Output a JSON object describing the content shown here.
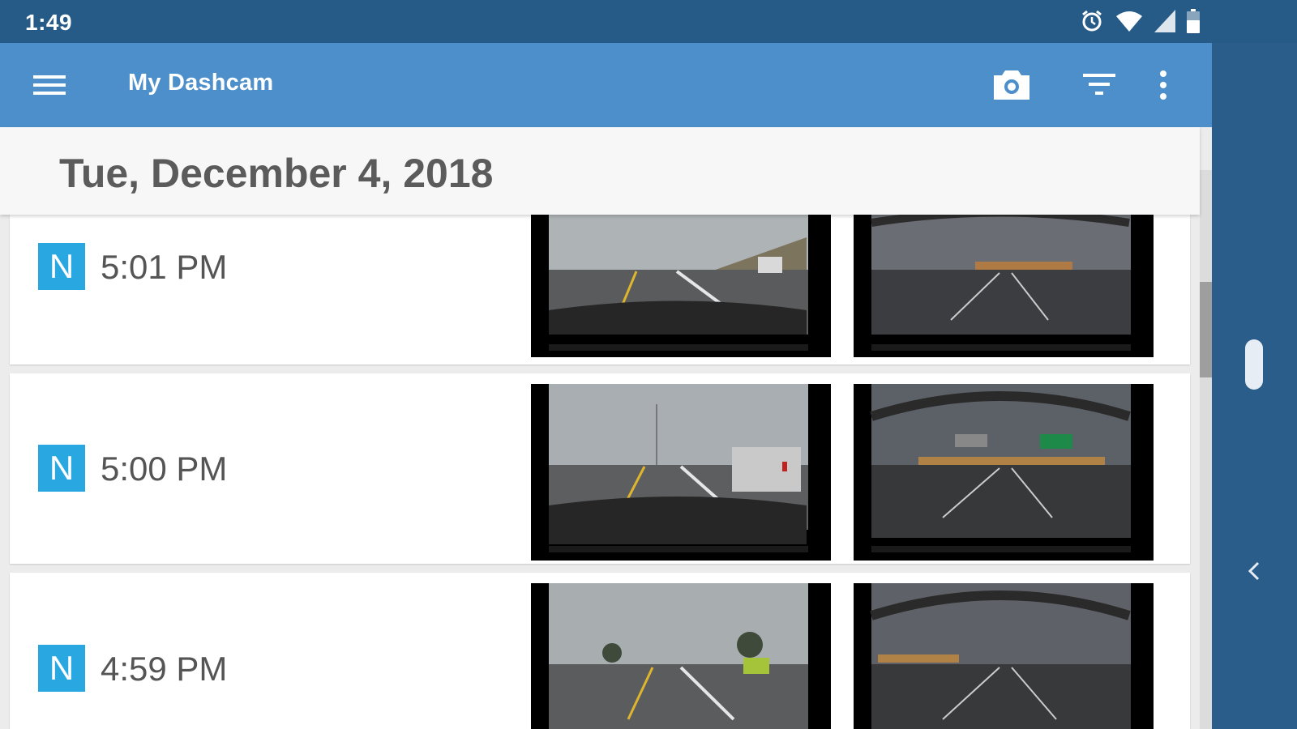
{
  "status_bar": {
    "time": "1:49",
    "icons": [
      "alarm-icon",
      "wifi-icon",
      "signal-icon",
      "battery-icon"
    ]
  },
  "app_bar": {
    "title": "My Dashcam",
    "actions": [
      "menu-icon",
      "camera-icon",
      "filter-icon",
      "more-vert-icon"
    ]
  },
  "date_header": "Tue, December 4, 2018",
  "recordings": [
    {
      "badge": "N",
      "time": "5:01 PM"
    },
    {
      "badge": "N",
      "time": "5:00 PM"
    },
    {
      "badge": "N",
      "time": "4:59 PM"
    }
  ],
  "colors": {
    "status_bar": "#275b87",
    "app_bar": "#4d8fca",
    "badge": "#29a7e1",
    "side_panel": "#2a5d8a"
  }
}
